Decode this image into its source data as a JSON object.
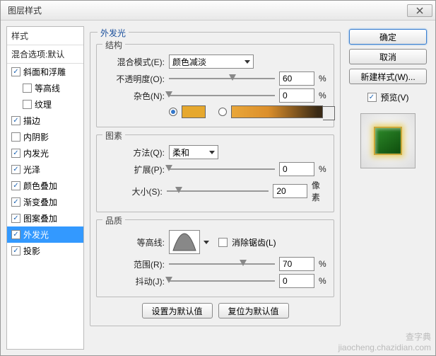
{
  "dialog": {
    "title": "图层样式"
  },
  "sidebar": {
    "header": "样式",
    "sub": "混合选项:默认",
    "items": [
      {
        "label": "斜面和浮雕",
        "checked": true,
        "indent": false
      },
      {
        "label": "等高线",
        "checked": false,
        "indent": true
      },
      {
        "label": "纹理",
        "checked": false,
        "indent": true
      },
      {
        "label": "描边",
        "checked": true,
        "indent": false
      },
      {
        "label": "内阴影",
        "checked": false,
        "indent": false
      },
      {
        "label": "内发光",
        "checked": true,
        "indent": false
      },
      {
        "label": "光泽",
        "checked": true,
        "indent": false
      },
      {
        "label": "颜色叠加",
        "checked": true,
        "indent": false
      },
      {
        "label": "渐变叠加",
        "checked": true,
        "indent": false
      },
      {
        "label": "图案叠加",
        "checked": true,
        "indent": false
      },
      {
        "label": "外发光",
        "checked": true,
        "indent": false,
        "selected": true
      },
      {
        "label": "投影",
        "checked": true,
        "indent": false
      }
    ]
  },
  "main": {
    "title": "外发光",
    "structure": {
      "title": "结构",
      "blend_label": "混合模式(E):",
      "blend_value": "颜色减淡",
      "opacity_label": "不透明度(O):",
      "opacity_value": "60",
      "opacity_unit": "%",
      "noise_label": "杂色(N):",
      "noise_value": "0",
      "noise_unit": "%"
    },
    "element": {
      "title": "图素",
      "method_label": "方法(Q):",
      "method_value": "柔和",
      "spread_label": "扩展(P):",
      "spread_value": "0",
      "spread_unit": "%",
      "size_label": "大小(S):",
      "size_value": "20",
      "size_unit": "像素"
    },
    "quality": {
      "title": "品质",
      "contour_label": "等高线:",
      "antialias_label": "消除锯齿(L)",
      "range_label": "范围(R):",
      "range_value": "70",
      "range_unit": "%",
      "jitter_label": "抖动(J):",
      "jitter_value": "0",
      "jitter_unit": "%"
    },
    "footer": {
      "default": "设置为默认值",
      "reset": "复位为默认值"
    }
  },
  "right": {
    "ok": "确定",
    "cancel": "取消",
    "newstyle": "新建样式(W)...",
    "preview_label": "预览(V)"
  },
  "watermark": {
    "line1": "查字典",
    "line2": "jiaocheng.chazidian.com"
  }
}
